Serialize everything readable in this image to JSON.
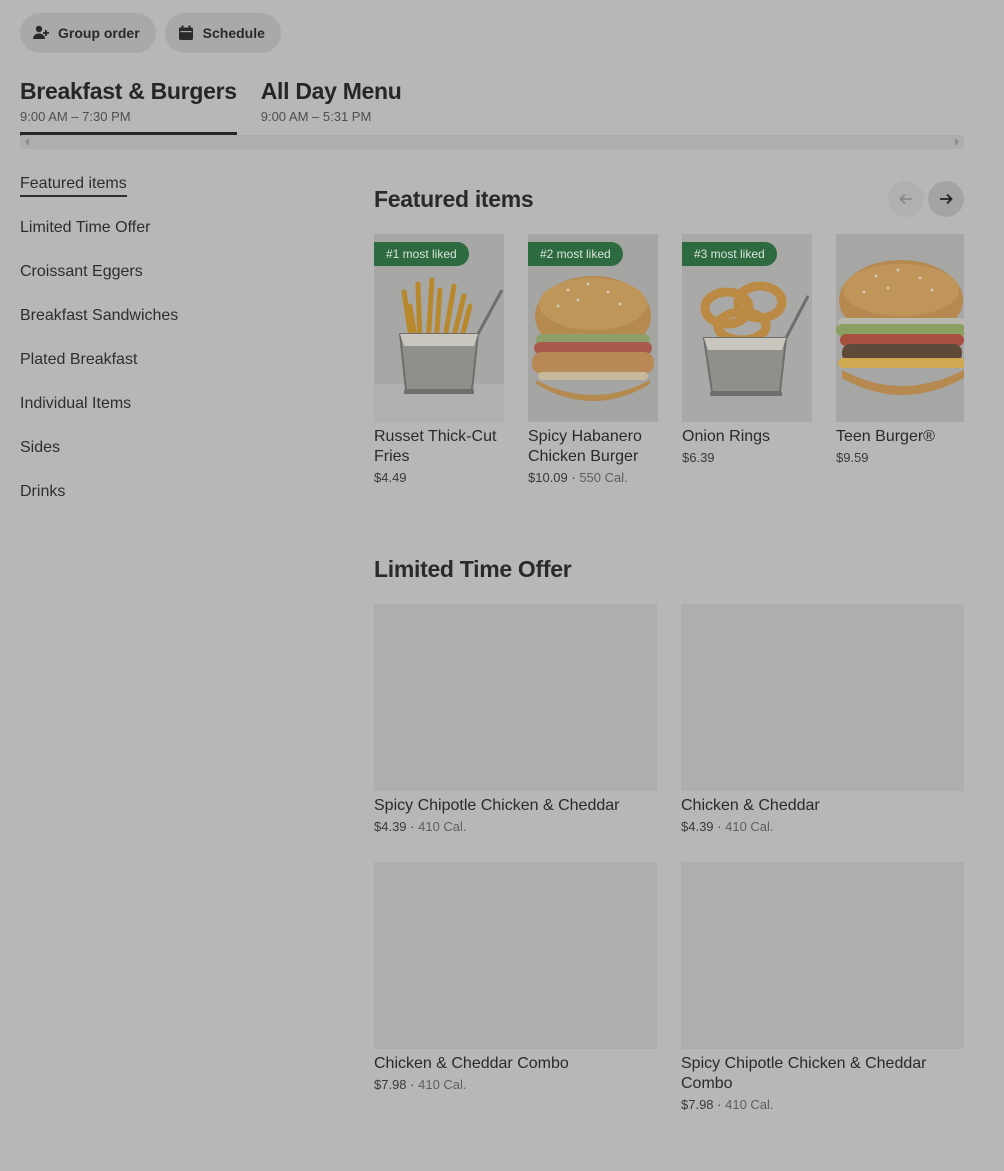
{
  "top_actions": {
    "group_order": "Group order",
    "schedule": "Schedule"
  },
  "menus": [
    {
      "name": "Breakfast & Burgers",
      "hours": "9:00 AM – 7:30 PM",
      "active": true
    },
    {
      "name": "All Day Menu",
      "hours": "9:00 AM – 5:31 PM",
      "active": false
    }
  ],
  "sidebar": {
    "items": [
      {
        "label": "Featured items",
        "active": true
      },
      {
        "label": "Limited Time Offer"
      },
      {
        "label": "Croissant Eggers"
      },
      {
        "label": "Breakfast Sandwiches"
      },
      {
        "label": "Plated Breakfast"
      },
      {
        "label": "Individual Items"
      },
      {
        "label": "Sides"
      },
      {
        "label": "Drinks"
      }
    ]
  },
  "featured": {
    "title": "Featured items",
    "items": [
      {
        "badge": "#1 most liked",
        "name": "Russet Thick-Cut Fries",
        "price": "$4.49",
        "calories": "",
        "image": "fries-basket"
      },
      {
        "badge": "#2 most liked",
        "name": "Spicy Habanero Chicken Burger",
        "price": "$10.09",
        "calories": "550 Cal.",
        "image": "chicken-burger"
      },
      {
        "badge": "#3 most liked",
        "name": "Onion Rings",
        "price": "$6.39",
        "calories": "",
        "image": "onion-rings-basket"
      },
      {
        "badge": "",
        "name": "Teen Burger®",
        "price": "$9.59",
        "calories": "",
        "image": "beef-burger"
      }
    ]
  },
  "limited": {
    "title": "Limited Time Offer",
    "items": [
      {
        "name": "Spicy Chipotle Chicken & Cheddar",
        "price": "$4.39",
        "calories": "410 Cal."
      },
      {
        "name": "Chicken & Cheddar",
        "price": "$4.39",
        "calories": "410 Cal."
      },
      {
        "name": "Chicken & Cheddar Combo",
        "price": "$7.98",
        "calories": "410 Cal."
      },
      {
        "name": "Spicy Chipotle Chicken & Cheddar Combo",
        "price": "$7.98",
        "calories": "410 Cal."
      }
    ]
  },
  "colors": {
    "overlay_bg": "#b7b7b7",
    "badge_bg": "#2d6a3f",
    "text": "#2c2c2c"
  }
}
